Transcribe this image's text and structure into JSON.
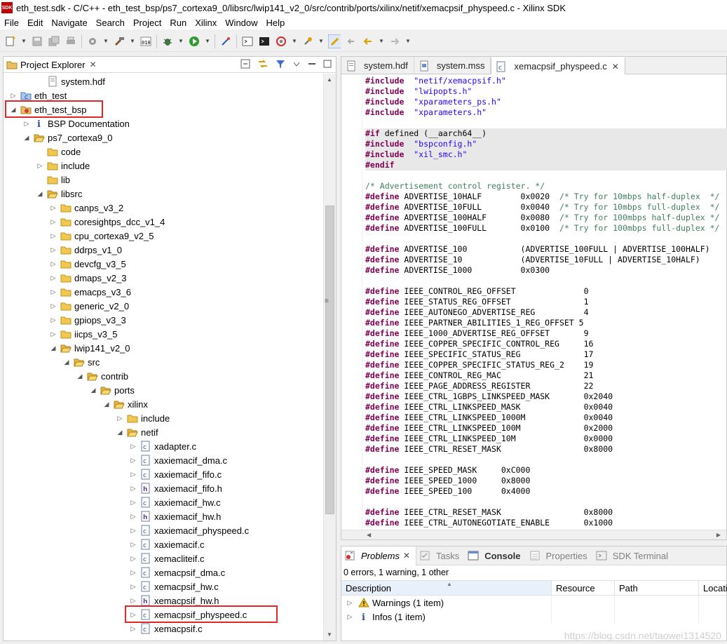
{
  "window": {
    "logo": "SDK",
    "title": "eth_test.sdk - C/C++ - eth_test_bsp/ps7_cortexa9_0/libsrc/lwip141_v2_0/src/contrib/ports/xilinx/netif/xemacpsif_physpeed.c - Xilinx SDK"
  },
  "menu": [
    "File",
    "Edit",
    "Navigate",
    "Search",
    "Project",
    "Run",
    "Xilinx",
    "Window",
    "Help"
  ],
  "project_explorer": {
    "title": "Project Explorer",
    "tree": [
      {
        "label": "system.hdf",
        "depth": 2,
        "icon": "hdf-file-icon",
        "arrow": ""
      },
      {
        "label": "eth_test",
        "depth": 0,
        "icon": "c-project-icon",
        "arrow": "▷"
      },
      {
        "label": "eth_test_bsp",
        "depth": 0,
        "icon": "bsp-project-icon",
        "arrow": "◢",
        "highlight": true
      },
      {
        "label": "BSP Documentation",
        "depth": 1,
        "icon": "info-icon",
        "arrow": "▷"
      },
      {
        "label": "ps7_cortexa9_0",
        "depth": 1,
        "icon": "folder-open-icon",
        "arrow": "◢"
      },
      {
        "label": "code",
        "depth": 2,
        "icon": "folder-icon",
        "arrow": ""
      },
      {
        "label": "include",
        "depth": 2,
        "icon": "folder-icon",
        "arrow": "▷"
      },
      {
        "label": "lib",
        "depth": 2,
        "icon": "folder-icon",
        "arrow": ""
      },
      {
        "label": "libsrc",
        "depth": 2,
        "icon": "folder-open-icon",
        "arrow": "◢"
      },
      {
        "label": "canps_v3_2",
        "depth": 3,
        "icon": "folder-icon",
        "arrow": "▷"
      },
      {
        "label": "coresightps_dcc_v1_4",
        "depth": 3,
        "icon": "folder-icon",
        "arrow": "▷"
      },
      {
        "label": "cpu_cortexa9_v2_5",
        "depth": 3,
        "icon": "folder-icon",
        "arrow": "▷"
      },
      {
        "label": "ddrps_v1_0",
        "depth": 3,
        "icon": "folder-icon",
        "arrow": "▷"
      },
      {
        "label": "devcfg_v3_5",
        "depth": 3,
        "icon": "folder-icon",
        "arrow": "▷"
      },
      {
        "label": "dmaps_v2_3",
        "depth": 3,
        "icon": "folder-icon",
        "arrow": "▷"
      },
      {
        "label": "emacps_v3_6",
        "depth": 3,
        "icon": "folder-icon",
        "arrow": "▷"
      },
      {
        "label": "generic_v2_0",
        "depth": 3,
        "icon": "folder-icon",
        "arrow": "▷"
      },
      {
        "label": "gpiops_v3_3",
        "depth": 3,
        "icon": "folder-icon",
        "arrow": "▷"
      },
      {
        "label": "iicps_v3_5",
        "depth": 3,
        "icon": "folder-icon",
        "arrow": "▷"
      },
      {
        "label": "lwip141_v2_0",
        "depth": 3,
        "icon": "folder-open-icon",
        "arrow": "◢"
      },
      {
        "label": "src",
        "depth": 4,
        "icon": "folder-open-icon",
        "arrow": "◢"
      },
      {
        "label": "contrib",
        "depth": 5,
        "icon": "folder-open-icon",
        "arrow": "◢"
      },
      {
        "label": "ports",
        "depth": 6,
        "icon": "folder-open-icon",
        "arrow": "◢"
      },
      {
        "label": "xilinx",
        "depth": 7,
        "icon": "folder-open-icon",
        "arrow": "◢"
      },
      {
        "label": "include",
        "depth": 8,
        "icon": "folder-icon",
        "arrow": "▷"
      },
      {
        "label": "netif",
        "depth": 8,
        "icon": "folder-open-icon",
        "arrow": "◢"
      },
      {
        "label": "xadapter.c",
        "depth": 9,
        "icon": "c-file-icon",
        "arrow": "▷"
      },
      {
        "label": "xaxiemacif_dma.c",
        "depth": 9,
        "icon": "c-file-icon",
        "arrow": "▷"
      },
      {
        "label": "xaxiemacif_fifo.c",
        "depth": 9,
        "icon": "c-file-icon",
        "arrow": "▷"
      },
      {
        "label": "xaxiemacif_fifo.h",
        "depth": 9,
        "icon": "h-file-icon",
        "arrow": "▷"
      },
      {
        "label": "xaxiemacif_hw.c",
        "depth": 9,
        "icon": "c-file-icon",
        "arrow": "▷"
      },
      {
        "label": "xaxiemacif_hw.h",
        "depth": 9,
        "icon": "h-file-icon",
        "arrow": "▷"
      },
      {
        "label": "xaxiemacif_physpeed.c",
        "depth": 9,
        "icon": "c-file-icon",
        "arrow": "▷"
      },
      {
        "label": "xaxiemacif.c",
        "depth": 9,
        "icon": "c-file-icon",
        "arrow": "▷"
      },
      {
        "label": "xemacliteif.c",
        "depth": 9,
        "icon": "c-file-icon",
        "arrow": "▷"
      },
      {
        "label": "xemacpsif_dma.c",
        "depth": 9,
        "icon": "c-file-icon",
        "arrow": "▷"
      },
      {
        "label": "xemacpsif_hw.c",
        "depth": 9,
        "icon": "c-file-icon",
        "arrow": "▷"
      },
      {
        "label": "xemacpsif_hw.h",
        "depth": 9,
        "icon": "h-file-icon",
        "arrow": "▷"
      },
      {
        "label": "xemacpsif_physpeed.c",
        "depth": 9,
        "icon": "c-file-icon",
        "arrow": "▷",
        "highlight": true
      },
      {
        "label": "xemacpsif.c",
        "depth": 9,
        "icon": "c-file-icon",
        "arrow": "▷"
      }
    ]
  },
  "editor": {
    "tabs": [
      {
        "label": "system.hdf",
        "icon": "hdf-file-icon",
        "active": false
      },
      {
        "label": "system.mss",
        "icon": "mss-file-icon",
        "active": false
      },
      {
        "label": "xemacpsif_physpeed.c",
        "icon": "c-file-icon",
        "active": true
      }
    ],
    "lines": [
      [
        [
          "kw",
          "#include"
        ],
        [
          "",
          "  "
        ],
        [
          "str",
          "\"netif/xemacpsif.h\""
        ]
      ],
      [
        [
          "kw",
          "#include"
        ],
        [
          "",
          "  "
        ],
        [
          "str",
          "\"lwipopts.h\""
        ]
      ],
      [
        [
          "kw",
          "#include"
        ],
        [
          "",
          "  "
        ],
        [
          "str",
          "\"xparameters_ps.h\""
        ]
      ],
      [
        [
          "kw",
          "#include"
        ],
        [
          "",
          "  "
        ],
        [
          "str",
          "\"xparameters.h\""
        ]
      ],
      [],
      [
        [
          "kw",
          "#if"
        ],
        [
          "",
          " defined (__aarch64__)"
        ]
      ],
      [
        [
          "kw",
          "#include"
        ],
        [
          "",
          "  "
        ],
        [
          "str",
          "\"bspconfig.h\""
        ]
      ],
      [
        [
          "kw",
          "#include"
        ],
        [
          "",
          "  "
        ],
        [
          "str",
          "\"xil_smc.h\""
        ]
      ],
      [
        [
          "kw",
          "#endif"
        ]
      ],
      [],
      [
        [
          "cmt",
          "/* Advertisement control register. */"
        ]
      ],
      [
        [
          "kw",
          "#define"
        ],
        [
          "",
          " ADVERTISE_10HALF        0x0020  "
        ],
        [
          "cmt",
          "/* Try for 10mbps half-duplex  */"
        ]
      ],
      [
        [
          "kw",
          "#define"
        ],
        [
          "",
          " ADVERTISE_10FULL        0x0040  "
        ],
        [
          "cmt",
          "/* Try for 10mbps full-duplex  */"
        ]
      ],
      [
        [
          "kw",
          "#define"
        ],
        [
          "",
          " ADVERTISE_100HALF       0x0080  "
        ],
        [
          "cmt",
          "/* Try for 100mbps half-duplex */"
        ]
      ],
      [
        [
          "kw",
          "#define"
        ],
        [
          "",
          " ADVERTISE_100FULL       0x0100  "
        ],
        [
          "cmt",
          "/* Try for 100mbps full-duplex */"
        ]
      ],
      [],
      [
        [
          "kw",
          "#define"
        ],
        [
          "",
          " ADVERTISE_100           (ADVERTISE_100FULL | ADVERTISE_100HALF)"
        ]
      ],
      [
        [
          "kw",
          "#define"
        ],
        [
          "",
          " ADVERTISE_10            (ADVERTISE_10FULL | ADVERTISE_10HALF)"
        ]
      ],
      [
        [
          "kw",
          "#define"
        ],
        [
          "",
          " ADVERTISE_1000          0x0300"
        ]
      ],
      [],
      [
        [
          "kw",
          "#define"
        ],
        [
          "",
          " IEEE_CONTROL_REG_OFFSET              0"
        ]
      ],
      [
        [
          "kw",
          "#define"
        ],
        [
          "",
          " IEEE_STATUS_REG_OFFSET               1"
        ]
      ],
      [
        [
          "kw",
          "#define"
        ],
        [
          "",
          " IEEE_AUTONEGO_ADVERTISE_REG          4"
        ]
      ],
      [
        [
          "kw",
          "#define"
        ],
        [
          "",
          " IEEE_PARTNER_ABILITIES_1_REG_OFFSET 5"
        ]
      ],
      [
        [
          "kw",
          "#define"
        ],
        [
          "",
          " IEEE_1000_ADVERTISE_REG_OFFSET       9"
        ]
      ],
      [
        [
          "kw",
          "#define"
        ],
        [
          "",
          " IEEE_COPPER_SPECIFIC_CONTROL_REG     16"
        ]
      ],
      [
        [
          "kw",
          "#define"
        ],
        [
          "",
          " IEEE_SPECIFIC_STATUS_REG             17"
        ]
      ],
      [
        [
          "kw",
          "#define"
        ],
        [
          "",
          " IEEE_COPPER_SPECIFIC_STATUS_REG_2    19"
        ]
      ],
      [
        [
          "kw",
          "#define"
        ],
        [
          "",
          " IEEE_CONTROL_REG_MAC                 21"
        ]
      ],
      [
        [
          "kw",
          "#define"
        ],
        [
          "",
          " IEEE_PAGE_ADDRESS_REGISTER           22"
        ]
      ],
      [
        [
          "kw",
          "#define"
        ],
        [
          "",
          " IEEE_CTRL_1GBPS_LINKSPEED_MASK       0x2040"
        ]
      ],
      [
        [
          "kw",
          "#define"
        ],
        [
          "",
          " IEEE_CTRL_LINKSPEED_MASK             0x0040"
        ]
      ],
      [
        [
          "kw",
          "#define"
        ],
        [
          "",
          " IEEE_CTRL_LINKSPEED_1000M            0x0040"
        ]
      ],
      [
        [
          "kw",
          "#define"
        ],
        [
          "",
          " IEEE_CTRL_LINKSPEED_100M             0x2000"
        ]
      ],
      [
        [
          "kw",
          "#define"
        ],
        [
          "",
          " IEEE_CTRL_LINKSPEED_10M              0x0000"
        ]
      ],
      [
        [
          "kw",
          "#define"
        ],
        [
          "",
          " IEEE_CTRL_RESET_MASK                 0x8000"
        ]
      ],
      [],
      [
        [
          "kw",
          "#define"
        ],
        [
          "",
          " IEEE_SPEED_MASK     0xC000"
        ]
      ],
      [
        [
          "kw",
          "#define"
        ],
        [
          "",
          " IEEE_SPEED_1000     0x8000"
        ]
      ],
      [
        [
          "kw",
          "#define"
        ],
        [
          "",
          " IEEE_SPEED_100      0x4000"
        ]
      ],
      [],
      [
        [
          "kw",
          "#define"
        ],
        [
          "",
          " IEEE_CTRL_RESET_MASK                 0x8000"
        ]
      ],
      [
        [
          "kw",
          "#define"
        ],
        [
          "",
          " IEEE_CTRL_AUTONEGOTIATE_ENABLE       0x1000"
        ]
      ]
    ]
  },
  "bottom": {
    "tabs": [
      {
        "label": "Problems",
        "icon": "problems-icon",
        "active": true
      },
      {
        "label": "Tasks",
        "icon": "tasks-icon",
        "active": false
      },
      {
        "label": "Console",
        "icon": "console-icon",
        "active": false,
        "bold": true
      },
      {
        "label": "Properties",
        "icon": "properties-icon",
        "active": false
      },
      {
        "label": "SDK Terminal",
        "icon": "terminal-icon",
        "active": false
      }
    ],
    "summary": "0 errors, 1 warning, 1 other",
    "columns": [
      "Description",
      "Resource",
      "Path",
      "Location"
    ],
    "rows": [
      {
        "label": "Warnings (1 item)",
        "icon": "warning-icon"
      },
      {
        "label": "Infos (1 item)",
        "icon": "info-icon"
      }
    ]
  },
  "watermark": "https://blog.csdn.net/taowei1314520"
}
